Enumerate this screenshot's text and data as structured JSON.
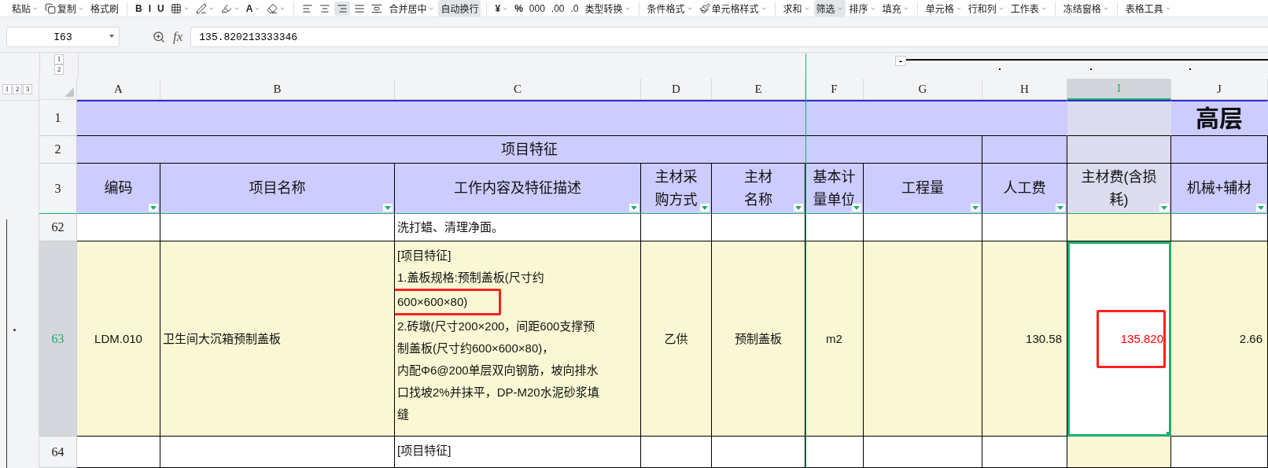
{
  "toolbar": [
    {
      "kind": "text",
      "label": "粘贴",
      "dropdown": true,
      "selected": false
    },
    {
      "kind": "icon",
      "label": "复制",
      "dropdown": true,
      "selected": false
    },
    {
      "kind": "text",
      "label": "格式刷",
      "dropdown": false,
      "selected": false
    },
    {
      "kind": "separator"
    },
    {
      "kind": "text",
      "label": "B",
      "dropdown": false,
      "selected": false
    },
    {
      "kind": "text",
      "label": "I",
      "dropdown": false,
      "selected": false
    },
    {
      "kind": "text",
      "label": "U",
      "dropdown": false,
      "selected": false
    },
    {
      "kind": "icon",
      "dropdown": true,
      "selected": false
    },
    {
      "kind": "icon",
      "dropdown": true,
      "selected": false
    },
    {
      "kind": "icon",
      "dropdown": true,
      "selected": false
    },
    {
      "kind": "text",
      "label": "A",
      "dropdown": true,
      "selected": false
    },
    {
      "kind": "icon",
      "dropdown": true,
      "selected": false
    },
    {
      "kind": "separator"
    },
    {
      "kind": "icon",
      "dropdown": false,
      "selected": false
    },
    {
      "kind": "icon",
      "dropdown": false,
      "selected": false
    },
    {
      "kind": "icon",
      "dropdown": false,
      "selected": true
    },
    {
      "kind": "icon",
      "dropdown": false,
      "selected": false
    },
    {
      "kind": "icon",
      "dropdown": false,
      "selected": false
    },
    {
      "kind": "text",
      "label": "合并居中",
      "dropdown": true,
      "selected": false
    },
    {
      "kind": "text",
      "label": "自动换行",
      "dropdown": false,
      "selected": true
    },
    {
      "kind": "separator"
    },
    {
      "kind": "text",
      "label": "¥",
      "dropdown": true,
      "selected": false
    },
    {
      "kind": "text",
      "label": "%",
      "dropdown": false,
      "selected": false
    },
    {
      "kind": "text",
      "label": "000",
      "dropdown": false,
      "selected": false
    },
    {
      "kind": "text",
      "label": ".00",
      "dropdown": false,
      "selected": false
    },
    {
      "kind": "text",
      "label": ".0",
      "dropdown": false,
      "selected": false
    },
    {
      "kind": "text",
      "label": "类型转换",
      "dropdown": true,
      "selected": false
    },
    {
      "kind": "separator"
    },
    {
      "kind": "text",
      "label": "条件格式",
      "dropdown": true,
      "selected": false
    },
    {
      "kind": "icon",
      "label": "单元格样式",
      "dropdown": true,
      "selected": false
    },
    {
      "kind": "separator"
    },
    {
      "kind": "text",
      "label": "求和",
      "dropdown": true,
      "selected": false
    },
    {
      "kind": "text",
      "label": "筛选",
      "dropdown": true,
      "selected": true
    },
    {
      "kind": "text",
      "label": "排序",
      "dropdown": true,
      "selected": false
    },
    {
      "kind": "text",
      "label": "填充",
      "dropdown": true,
      "selected": false
    },
    {
      "kind": "separator"
    },
    {
      "kind": "text",
      "label": "单元格",
      "dropdown": true,
      "selected": false
    },
    {
      "kind": "text",
      "label": "行和列",
      "dropdown": true,
      "selected": false
    },
    {
      "kind": "text",
      "label": "工作表",
      "dropdown": true,
      "selected": false
    },
    {
      "kind": "separator"
    },
    {
      "kind": "text",
      "label": "冻结窗格",
      "dropdown": true,
      "selected": false
    },
    {
      "kind": "separator"
    },
    {
      "kind": "text",
      "label": "表格工具",
      "dropdown": true,
      "selected": false
    }
  ],
  "formula_bar": {
    "name_box": "I63",
    "function_label": "fx",
    "formula": "135.820213333346"
  },
  "outline": {
    "column_levels": [
      "1",
      "2"
    ],
    "row_levels": [
      "1",
      "2",
      "3"
    ],
    "collapse_button": "-"
  },
  "columns": [
    {
      "letter": "A",
      "selected": false
    },
    {
      "letter": "B",
      "selected": false
    },
    {
      "letter": "C",
      "selected": false
    },
    {
      "letter": "D",
      "selected": false
    },
    {
      "letter": "E",
      "selected": false
    },
    {
      "letter": "F",
      "selected": false
    },
    {
      "letter": "G",
      "selected": false
    },
    {
      "letter": "H",
      "selected": false
    },
    {
      "letter": "I",
      "selected": true
    },
    {
      "letter": "J",
      "selected": false
    }
  ],
  "rows": [
    {
      "number": "1",
      "kind": "banner",
      "selected": false,
      "cells": [
        {
          "selected": false
        },
        {
          "selected": false
        },
        {
          "text": "高层",
          "selected": false
        }
      ]
    },
    {
      "number": "2",
      "kind": "group",
      "selected": false,
      "cells": [
        {
          "text": "项目特征",
          "selected": false
        },
        {
          "selected": false
        },
        {
          "selected": false
        },
        {
          "selected": false
        }
      ]
    },
    {
      "number": "3",
      "kind": "header",
      "selected": false,
      "cells": [
        {
          "head": [
            "编码"
          ],
          "filter": true,
          "selected": false
        },
        {
          "head": [
            "项目名称"
          ],
          "filter": true,
          "selected": false
        },
        {
          "head": [
            "工作内容及特征描述"
          ],
          "filter": true,
          "selected": false
        },
        {
          "head": [
            "主材采",
            "购方式"
          ],
          "filter": true,
          "selected": false
        },
        {
          "head": [
            "主材",
            "名称"
          ],
          "filter": true,
          "selected": false
        },
        {
          "head": [
            "基本计",
            "量单位"
          ],
          "filter": true,
          "selected": false
        },
        {
          "head": [
            "工程量"
          ],
          "filter": true,
          "selected": false
        },
        {
          "head": [
            "人工费"
          ],
          "filter": true,
          "selected": false
        },
        {
          "head": [
            "主材费(含损",
            "耗)"
          ],
          "filter": true,
          "selected": false
        },
        {
          "head": [
            "机械+辅材"
          ],
          "filter": true,
          "selected": false
        }
      ]
    },
    {
      "number": "62",
      "kind": "body",
      "selected": false,
      "cells": [
        {
          "selected": false
        },
        {
          "selected": false
        },
        {
          "kind": "text",
          "text": "洗打蜡、清理净面。",
          "selected": false
        },
        {
          "selected": false
        },
        {
          "selected": false
        },
        {
          "selected": false
        },
        {
          "selected": false
        },
        {
          "selected": false
        },
        {
          "selected": false
        },
        {
          "selected": false
        }
      ]
    },
    {
      "number": "63",
      "kind": "body",
      "selected": true,
      "cells": [
        {
          "text": "LDM.010",
          "selected": false
        },
        {
          "kind": "text",
          "text": "卫生间大沉箱预制盖板",
          "selected": false
        },
        {
          "kind": "text",
          "selected": false,
          "lines": [
            {
              "text": "[项目特征]",
              "boxed": false
            },
            {
              "text": "1.盖板规格:预制盖板(尺寸约",
              "boxed": false
            },
            {
              "text": "600×600×80)",
              "boxed": true
            },
            {
              "text": "2.砖墩(尺寸200×200，间距600支撑预",
              "boxed": false
            },
            {
              "text": "制盖板(尺寸约600×600×80)，",
              "boxed": false
            },
            {
              "text": "内配Φ6@200单层双向钢筋，坡向排水",
              "boxed": false
            },
            {
              "text": "口找坡2%并抹平，DP-M20水泥砂浆填",
              "boxed": false
            },
            {
              "text": "缝",
              "boxed": false
            }
          ]
        },
        {
          "text": "乙供",
          "selected": false
        },
        {
          "text": "预制盖板",
          "selected": false
        },
        {
          "text": "m2",
          "selected": false
        },
        {
          "selected": false
        },
        {
          "kind": "number",
          "text": "130.58",
          "selected": false
        },
        {
          "kind": "number",
          "text": "135.820",
          "color": "#ff0000",
          "boxed": true,
          "selected": true
        },
        {
          "kind": "number",
          "text": "2.66",
          "selected": false
        }
      ]
    },
    {
      "number": "64",
      "kind": "body",
      "selected": false,
      "cells": [
        {
          "selected": false
        },
        {
          "selected": false
        },
        {
          "kind": "text",
          "selected": false,
          "lines": [
            {
              "text": "[项目特征]",
              "boxed": false
            }
          ]
        },
        {
          "selected": false
        },
        {
          "selected": false
        },
        {
          "selected": false
        },
        {
          "selected": false
        },
        {
          "selected": false
        },
        {
          "selected": false
        },
        {
          "selected": false
        }
      ]
    }
  ]
}
